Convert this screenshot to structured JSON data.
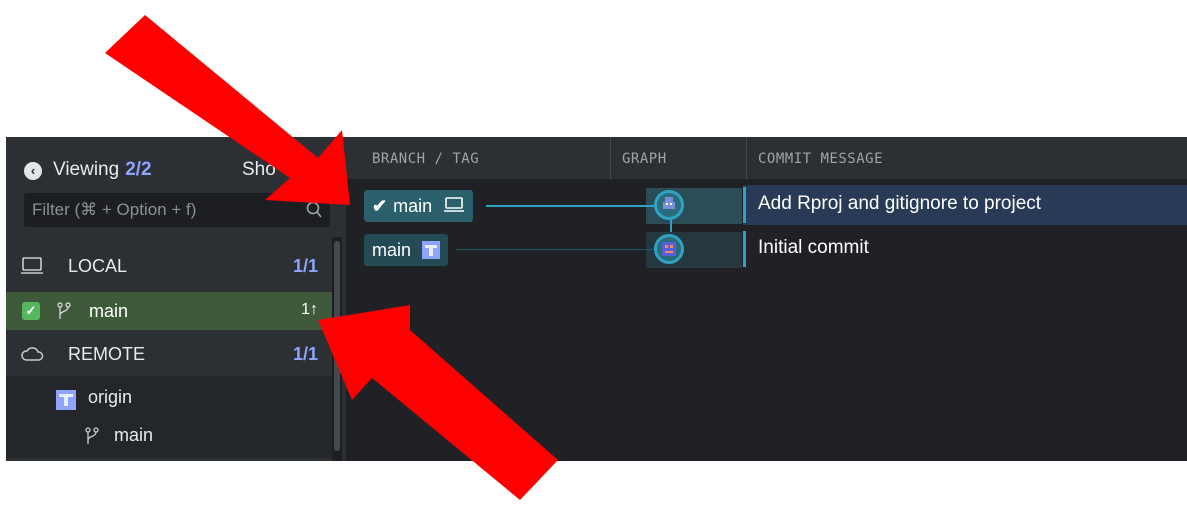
{
  "sidebar": {
    "viewing_label": "Viewing",
    "viewing_count": "2/2",
    "show_label": "Sho",
    "filter_placeholder": "Filter (⌘ + Option + f)",
    "local": {
      "label": "LOCAL",
      "count": "1/1"
    },
    "local_branch": {
      "label": "main",
      "ahead": "1↑",
      "checked": true
    },
    "remote": {
      "label": "REMOTE",
      "count": "1/1"
    },
    "origin": {
      "label": "origin"
    },
    "remote_branch": {
      "label": "main"
    }
  },
  "graph": {
    "columns": [
      "BRANCH / TAG",
      "GRAPH",
      "COMMIT MESSAGE"
    ],
    "commits": [
      {
        "branch_label": "main",
        "checkmark": "✔",
        "message": "Add Rproj and gitignore to project",
        "selected": true
      },
      {
        "branch_label": "main",
        "message": "Initial commit",
        "selected": false
      }
    ]
  },
  "colors": {
    "accent": "#2fa3c4",
    "count": "#8fa3ff",
    "local_branch_bg": "#3e5a3a",
    "arrow": "#ff0000"
  },
  "icons": {
    "back": "back-circle-icon",
    "search": "search-icon",
    "local": "laptop-icon",
    "remote": "cloud-icon",
    "branch": "branch-icon"
  }
}
